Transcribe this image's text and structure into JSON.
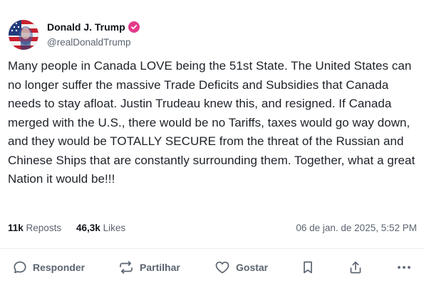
{
  "author": {
    "display_name": "Donald J. Trump",
    "handle": "@realDonaldTrump",
    "avatar": "american-flag-portrait",
    "verified_icon": "verified-badge-icon",
    "verified_color": "#e23b8a"
  },
  "post": {
    "text": "Many people in Canada LOVE being the 51st State. The United States can no longer suffer the massive Trade Deficits and Subsidies that Canada needs to stay afloat. Justin Trudeau knew this, and resigned. If Canada merged with the U.S., there would be no Tariffs, taxes would go way down, and they would be TOTALLY SECURE from the threat of the Russian and Chinese Ships that are constantly surrounding them. Together, what a great Nation it would be!!!"
  },
  "stats": {
    "reposts_count": "11k",
    "reposts_label": "Reposts",
    "likes_count": "46,3k",
    "likes_label": "Likes",
    "timestamp": "06 de jan. de 2025, 5:52 PM"
  },
  "actions": {
    "reply_label": "Responder",
    "share_label": "Partilhar",
    "like_label": "Gostar"
  }
}
